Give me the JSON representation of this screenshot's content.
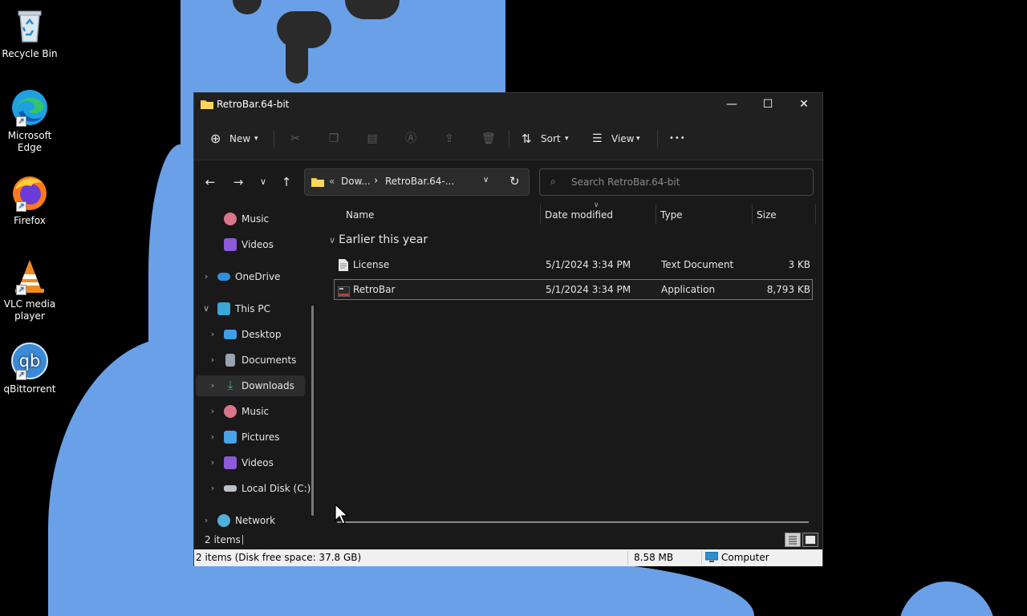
{
  "desktop": {
    "icons": [
      {
        "label": "Recycle Bin"
      },
      {
        "label": "Microsoft Edge"
      },
      {
        "label": "Firefox"
      },
      {
        "label": "VLC media player"
      },
      {
        "label": "qBittorrent"
      }
    ]
  },
  "window": {
    "title": "RetroBar.64-bit",
    "controls": {
      "minimize": "—",
      "maximize": "☐",
      "close": "✕"
    }
  },
  "toolbar": {
    "new_label": "New",
    "sort_label": "Sort",
    "view_label": "View",
    "more_label": "•••"
  },
  "address": {
    "crumb_prefix": "«",
    "crumb_1": "Dow...",
    "separator": "›",
    "crumb_2": "RetroBar.64-...",
    "search_placeholder": "Search RetroBar.64-bit"
  },
  "sidebar": {
    "items": [
      {
        "label": "Music"
      },
      {
        "label": "Videos"
      },
      {
        "label": "OneDrive"
      },
      {
        "label": "This PC"
      },
      {
        "label": "Desktop"
      },
      {
        "label": "Documents"
      },
      {
        "label": "Downloads"
      },
      {
        "label": "Music"
      },
      {
        "label": "Pictures"
      },
      {
        "label": "Videos"
      },
      {
        "label": "Local Disk (C:)"
      },
      {
        "label": "Network"
      }
    ]
  },
  "columns": {
    "name": "Name",
    "date": "Date modified",
    "type": "Type",
    "size": "Size"
  },
  "group_label": "Earlier this year",
  "files": [
    {
      "name": "License",
      "date": "5/1/2024 3:34 PM",
      "type": "Text Document",
      "size": "3 KB"
    },
    {
      "name": "RetroBar",
      "date": "5/1/2024 3:34 PM",
      "type": "Application",
      "size": "8,793 KB"
    }
  ],
  "status": {
    "items_count": "2 items",
    "classic_left": "2 items (Disk free space: 37.8 GB)",
    "classic_size": "8.58 MB",
    "classic_location": "Computer"
  },
  "colors": {
    "wallpaper_blue": "#6aa0e8",
    "window_bg": "#191919",
    "folder_yellow": "#f5c542"
  }
}
